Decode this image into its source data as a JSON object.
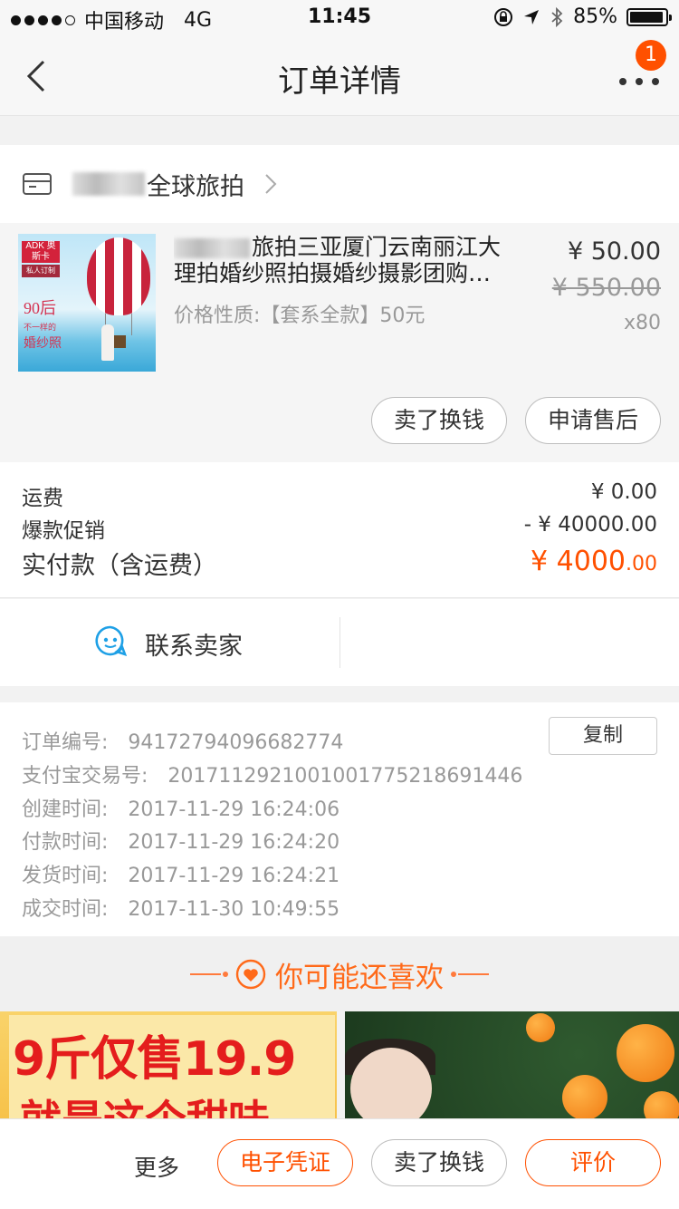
{
  "status_bar": {
    "carrier": "中国移动",
    "network": "4G",
    "time": "11:45",
    "battery": "85%"
  },
  "nav": {
    "title": "订单详情",
    "badge": "1"
  },
  "shop": {
    "name": "全球旅拍"
  },
  "item": {
    "title": "旅拍三亚厦门云南丽江大理拍婚纱照拍摄婚纱摄影团购…",
    "meta": "价格性质:【套系全款】50元",
    "price": "¥ 50.00",
    "original_price": "¥ 550.00",
    "quantity": "x80",
    "thumb": {
      "logo": "ADK 奥斯卡",
      "tag": "私人订制",
      "headline": "90后",
      "sub1": "不一样的",
      "sub2": "婚纱照"
    },
    "buttons": {
      "sell": "卖了换钱",
      "after_sale": "申请售后"
    }
  },
  "fees": {
    "shipping_label": "运费",
    "shipping_value": "¥ 0.00",
    "promo_label": "爆款促销",
    "promo_value": "- ¥ 40000.00",
    "total_label": "实付款（含运费）",
    "total_int": "¥ 4000",
    "total_dec": ".00"
  },
  "contact": {
    "label": "联系卖家"
  },
  "order_info": {
    "copy_label": "复制",
    "rows": [
      {
        "label": "订单编号:",
        "value": "94172794096682774"
      },
      {
        "label": "支付宝交易号:",
        "value": "2017112921001001775218691446"
      },
      {
        "label": "创建时间:",
        "value": "2017-11-29 16:24:06"
      },
      {
        "label": "付款时间:",
        "value": "2017-11-29 16:24:20"
      },
      {
        "label": "发货时间:",
        "value": "2017-11-29 16:24:21"
      },
      {
        "label": "成交时间:",
        "value": "2017-11-30 10:49:55"
      }
    ]
  },
  "recommend": {
    "title": "你可能还喜欢",
    "promo_line1": "9斤仅售19.9",
    "promo_line2": "就是这个甜味"
  },
  "bottom_bar": {
    "more": "更多",
    "voucher": "电子凭证",
    "sell": "卖了换钱",
    "review": "评价"
  },
  "colors": {
    "accent": "#ff5000",
    "text": "#333333",
    "muted": "#999999"
  },
  "icons": [
    "back-icon",
    "more-icon",
    "shop-icon",
    "chevron-right-icon",
    "chat-icon",
    "heart-icon"
  ]
}
